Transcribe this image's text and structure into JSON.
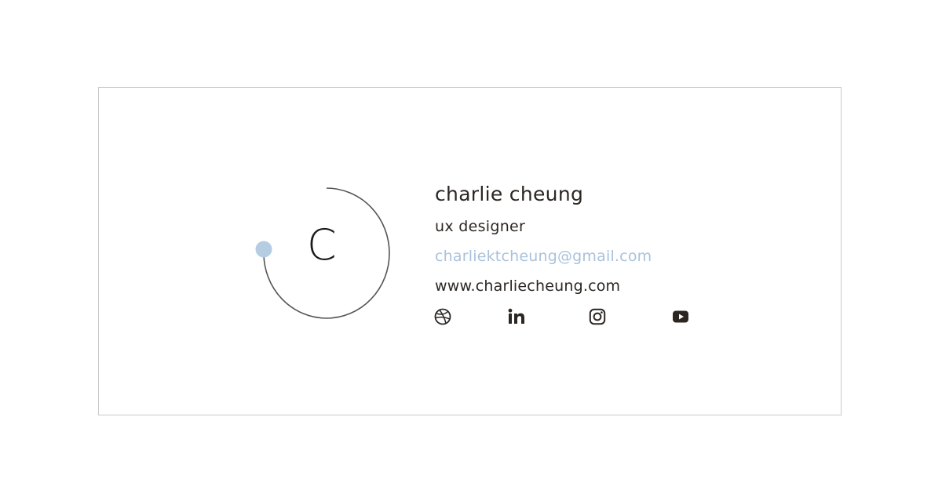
{
  "signature": {
    "monogram": "C",
    "name": "charlie cheung",
    "title": "ux designer",
    "email": "charliektcheung@gmail.com",
    "website": "www.charliecheung.com"
  },
  "social": [
    {
      "icon": "dribbble-icon"
    },
    {
      "icon": "linkedin-icon"
    },
    {
      "icon": "instagram-icon"
    },
    {
      "icon": "youtube-icon"
    }
  ],
  "colors": {
    "text": "#2b2622",
    "accent": "#a9c2dc",
    "ring": "#555555",
    "border": "#c9c9c9"
  }
}
